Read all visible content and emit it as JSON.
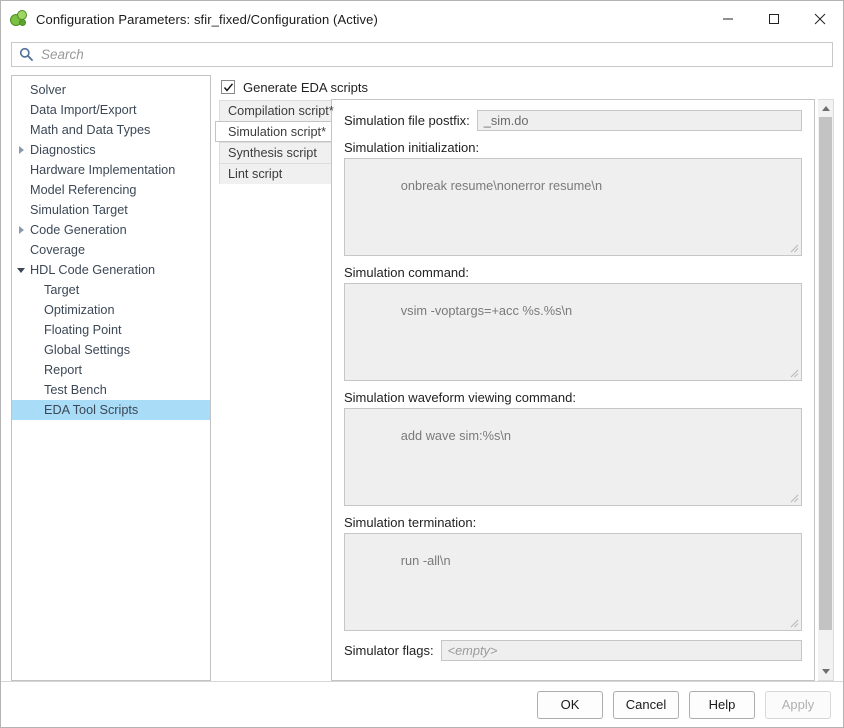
{
  "window": {
    "title": "Configuration Parameters: sfir_fixed/Configuration (Active)",
    "icon": "simulink-icon",
    "minimize_label": "—",
    "maximize_label": "□",
    "close_label": "✕"
  },
  "search": {
    "placeholder": "Search",
    "value": "",
    "icon": "search-icon"
  },
  "sidebar": {
    "items": [
      {
        "label": "Solver",
        "depth": 0,
        "expander": "none",
        "selected": false
      },
      {
        "label": "Data Import/Export",
        "depth": 0,
        "expander": "none",
        "selected": false
      },
      {
        "label": "Math and Data Types",
        "depth": 0,
        "expander": "none",
        "selected": false
      },
      {
        "label": "Diagnostics",
        "depth": 0,
        "expander": "collapsed",
        "selected": false
      },
      {
        "label": "Hardware Implementation",
        "depth": 0,
        "expander": "none",
        "selected": false
      },
      {
        "label": "Model Referencing",
        "depth": 0,
        "expander": "none",
        "selected": false
      },
      {
        "label": "Simulation Target",
        "depth": 0,
        "expander": "none",
        "selected": false
      },
      {
        "label": "Code Generation",
        "depth": 0,
        "expander": "collapsed",
        "selected": false
      },
      {
        "label": "Coverage",
        "depth": 0,
        "expander": "none",
        "selected": false
      },
      {
        "label": "HDL Code Generation",
        "depth": 0,
        "expander": "expanded",
        "selected": false
      },
      {
        "label": "Target",
        "depth": 1,
        "expander": "none",
        "selected": false
      },
      {
        "label": "Optimization",
        "depth": 1,
        "expander": "none",
        "selected": false
      },
      {
        "label": "Floating Point",
        "depth": 1,
        "expander": "none",
        "selected": false
      },
      {
        "label": "Global Settings",
        "depth": 1,
        "expander": "none",
        "selected": false
      },
      {
        "label": "Report",
        "depth": 1,
        "expander": "none",
        "selected": false
      },
      {
        "label": "Test Bench",
        "depth": 1,
        "expander": "none",
        "selected": false
      },
      {
        "label": "EDA Tool Scripts",
        "depth": 1,
        "expander": "none",
        "selected": true
      }
    ],
    "selection_color": "#a9dcf7"
  },
  "main": {
    "generate_scripts": {
      "label": "Generate EDA scripts",
      "checked": true,
      "check_glyph": "✔"
    },
    "tabs": [
      {
        "label": "Compilation script*",
        "active": false
      },
      {
        "label": "Simulation script*",
        "active": true
      },
      {
        "label": "Synthesis script",
        "active": false
      },
      {
        "label": "Lint script",
        "active": false
      }
    ],
    "fields": {
      "file_postfix": {
        "label": "Simulation file postfix:",
        "value": "_sim.do"
      },
      "initialization": {
        "label": "Simulation initialization:",
        "value": "onbreak resume\\nonerror resume\\n"
      },
      "command": {
        "label": "Simulation command:",
        "value": "vsim -voptargs=+acc %s.%s\\n"
      },
      "waveform": {
        "label": "Simulation waveform viewing command:",
        "value": "add wave sim:%s\\n"
      },
      "termination": {
        "label": "Simulation termination:",
        "value": "run -all\\n"
      },
      "simulator_flags": {
        "label": "Simulator flags:",
        "value": "",
        "placeholder": "<empty>"
      }
    }
  },
  "footer": {
    "ok": "OK",
    "cancel": "Cancel",
    "help": "Help",
    "apply": "Apply",
    "apply_enabled": false
  }
}
